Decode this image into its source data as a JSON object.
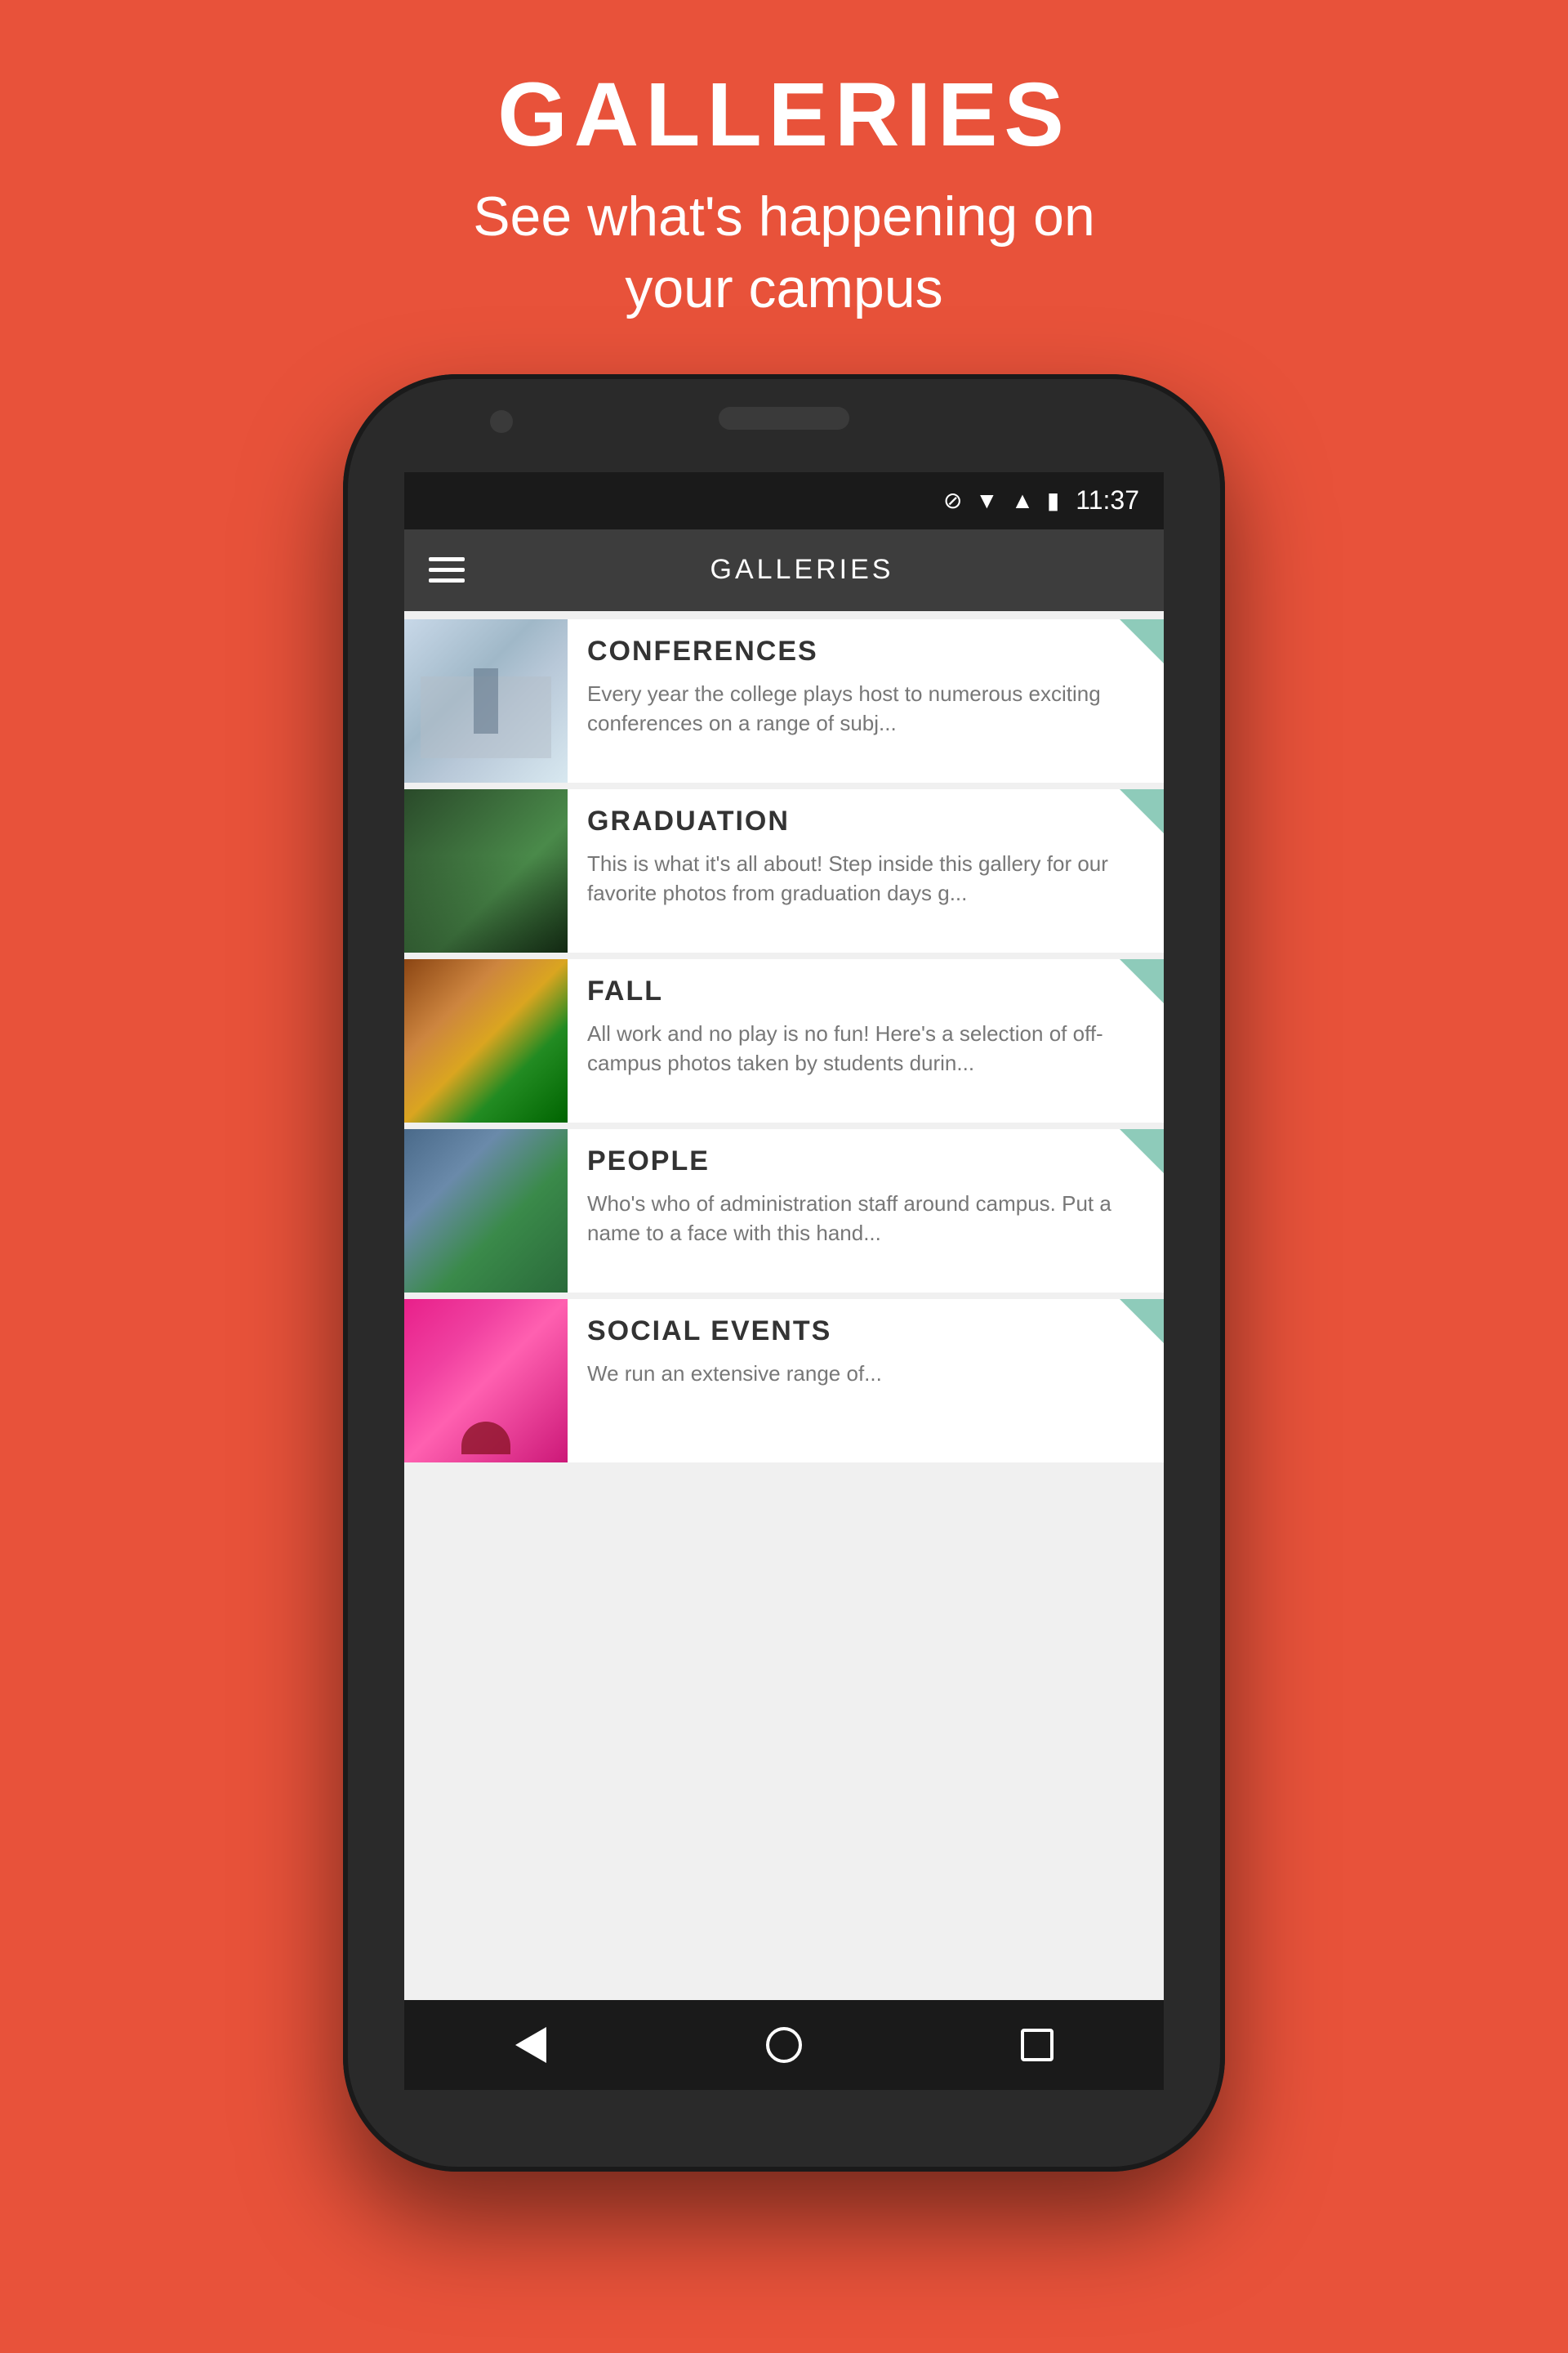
{
  "page": {
    "background_color": "#e8523a",
    "title": "GALLERIES",
    "subtitle": "See what's happening on\nyour campus"
  },
  "status_bar": {
    "time": "11:37",
    "icons": [
      "no-sim",
      "wifi",
      "signal",
      "battery"
    ]
  },
  "toolbar": {
    "title": "GALLERIES",
    "menu_label": "Menu"
  },
  "gallery_items": [
    {
      "id": "conferences",
      "title": "CONFERENCES",
      "description": "Every year the college plays host to numerous exciting conferences on a range of subj..."
    },
    {
      "id": "graduation",
      "title": "GRADUATION",
      "description": "This is what it's all about!  Step inside this gallery for our favorite photos from graduation days g..."
    },
    {
      "id": "fall",
      "title": "FALL",
      "description": "All work and no play is no fun! Here's a selection of off-campus photos taken by students durin..."
    },
    {
      "id": "people",
      "title": "PEOPLE",
      "description": "Who's who of administration staff around campus.  Put a name to a face with this hand..."
    },
    {
      "id": "social-events",
      "title": "SOCIAL EVENTS",
      "description": "We run an extensive range of..."
    }
  ],
  "nav_bar": {
    "back_label": "Back",
    "home_label": "Home",
    "recent_label": "Recent Apps"
  }
}
